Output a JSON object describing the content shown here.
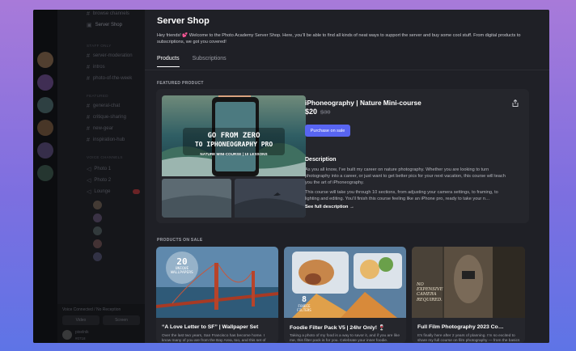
{
  "page": {
    "title": "Server Shop",
    "intro": "Hey friends! 💕 Welcome to the Photo Academy Server Shop. Here, you’ll be able to find all kinds of neat ways to support the server and buy some cool stuff. From digital products to subscriptions, we got you covered!",
    "tabs": [
      {
        "label": "Products",
        "active": true
      },
      {
        "label": "Subscriptions",
        "active": false
      }
    ]
  },
  "featured": {
    "section_label": "FEATURED PRODUCT",
    "title": "iPhoneography | Nature Mini-course",
    "price": "$20",
    "original_price": "$30",
    "cta": "Purchase on sale",
    "image_caption_line1": "GO FROM ZERO",
    "image_caption_line2": "TO IPHONEOGRAPHY PRO",
    "image_caption_sub": "NATURE MINI-COURSE | 10 LESSONS",
    "description_heading": "Description",
    "description_p1": "As you all know, I’ve built my career on nature photography. Whether you are looking to turn photography into a career, or just want to get better pics for your next vacation, this course will teach you the art of iPhoneography.",
    "description_p2": "This course will take you through 10 sections, from adjusting your camera settings, to framing, to lighting and editing. You’ll finish this course feeling like an iPhone pro, ready to take your n…",
    "see_full": "See full description"
  },
  "on_sale": {
    "section_label": "PRODUCTS ON SALE",
    "items": [
      {
        "title": "“A Love Letter to SF” | Wallpaper Set",
        "desc": "Over the last two years, San Francisco has become home. I know many of you are from the Bay Area, too, and this set of",
        "badge_top": "20",
        "badge_bottom": "UNIQUE WALLPAPERS"
      },
      {
        "title": "Foodie Filter Pack V5 | 24hr Only! 🍷",
        "desc": "Taking a photo of my food is a way to savor it, and if you are like me, this filter pack is for you. Celebrate your inner foodie.",
        "badge_top": "8",
        "badge_bottom": "FOODIE FILTERS"
      },
      {
        "title": "Full Film Photography 2023 Co…",
        "desc": "It’s finally here after 2 years of planning. I’m so excited to share my full course on film photography — from the basics to",
        "overlay_line1": "NO",
        "overlay_line2": "EXPENSIVE",
        "overlay_line3": "CAMERA",
        "overlay_line4": "REQUIRED."
      }
    ]
  },
  "sidebar": {
    "channels": [
      {
        "label": "browse channels",
        "top": 0
      },
      {
        "label": "Server Shop",
        "top": 0
      }
    ],
    "group1": "STAFF ONLY",
    "group1_items": [
      "server-moderation",
      "intros",
      "photo-of-the-week"
    ],
    "group2": "FEATURED",
    "group2_items": [
      "general-chat",
      "critique-sharing",
      "new-gear",
      "inspiration-hub"
    ],
    "group3": "VOICE CHANNELS",
    "group3_items": [
      "Photo 1",
      "Photo 2",
      "Lounge"
    ],
    "footer_status": "Voice Connected / No Reception",
    "footer_btn1": "Video",
    "footer_btn2": "Screen",
    "user_name": "pixelnik",
    "user_tag": "#0718"
  }
}
